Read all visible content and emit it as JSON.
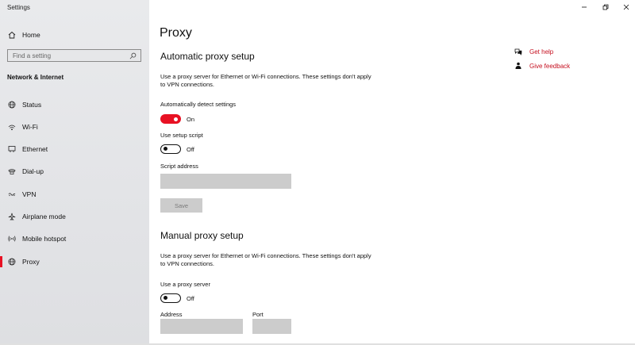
{
  "window": {
    "title": "Settings"
  },
  "sidebar": {
    "home_label": "Home",
    "search_placeholder": "Find a setting",
    "section_title": "Network & Internet",
    "items": [
      {
        "label": "Status",
        "icon": "globe-icon"
      },
      {
        "label": "Wi-Fi",
        "icon": "wifi-icon"
      },
      {
        "label": "Ethernet",
        "icon": "ethernet-icon"
      },
      {
        "label": "Dial-up",
        "icon": "dialup-icon"
      },
      {
        "label": "VPN",
        "icon": "vpn-icon"
      },
      {
        "label": "Airplane mode",
        "icon": "airplane-icon"
      },
      {
        "label": "Mobile hotspot",
        "icon": "hotspot-icon"
      },
      {
        "label": "Proxy",
        "icon": "globe-icon",
        "active": true
      }
    ]
  },
  "main": {
    "title": "Proxy",
    "automatic": {
      "heading": "Automatic proxy setup",
      "description": "Use a proxy server for Ethernet or Wi-Fi connections. These settings don't apply to VPN connections.",
      "detect_label": "Automatically detect settings",
      "detect_state": "On",
      "script_label": "Use setup script",
      "script_state": "Off",
      "address_label": "Script address",
      "address_value": "",
      "save_label": "Save"
    },
    "manual": {
      "heading": "Manual proxy setup",
      "description": "Use a proxy server for Ethernet or Wi-Fi connections. These settings don't apply to VPN connections.",
      "use_proxy_label": "Use a proxy server",
      "use_proxy_state": "Off",
      "address_label": "Address",
      "port_label": "Port",
      "address_value": "",
      "port_value": ""
    }
  },
  "help": {
    "get_help": "Get help",
    "give_feedback": "Give feedback"
  },
  "colors": {
    "accent": "#e81123",
    "link": "#c50f1f",
    "sidebar_bg": "#e6e7ea",
    "field": "#cccccc"
  }
}
